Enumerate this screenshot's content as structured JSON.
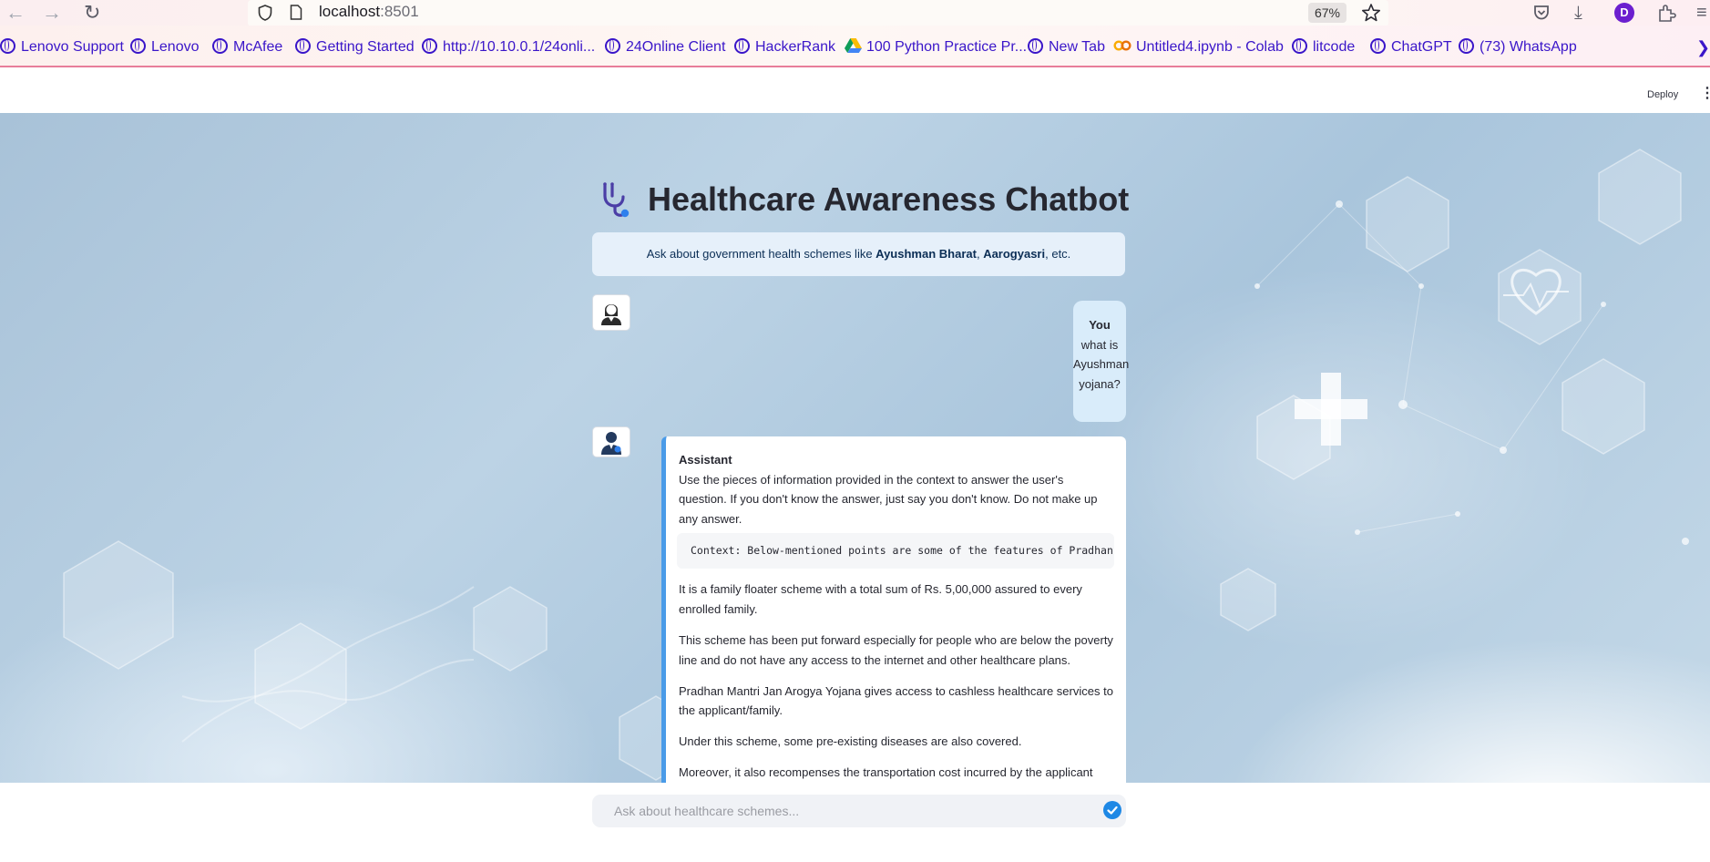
{
  "browser": {
    "url_host": "localhost",
    "url_port": ":8501",
    "zoom": "67%",
    "profile_initial": "D",
    "bookmarks": [
      {
        "label": "Lenovo Support",
        "icon": "globe-icon"
      },
      {
        "label": "Lenovo",
        "icon": "globe-icon"
      },
      {
        "label": "McAfee",
        "icon": "globe-icon"
      },
      {
        "label": "Getting Started",
        "icon": "globe-icon"
      },
      {
        "label": "http://10.10.0.1/24onli...",
        "icon": "globe-icon"
      },
      {
        "label": "24Online Client",
        "icon": "globe-icon"
      },
      {
        "label": "HackerRank",
        "icon": "globe-icon"
      },
      {
        "label": "100 Python Practice Pr...",
        "icon": "google-drive-icon"
      },
      {
        "label": "New Tab",
        "icon": "globe-icon"
      },
      {
        "label": "Untitled4.ipynb - Colab",
        "icon": "colab-icon"
      },
      {
        "label": "litcode",
        "icon": "globe-icon"
      },
      {
        "label": "ChatGPT",
        "icon": "globe-icon"
      },
      {
        "label": "(73) WhatsApp",
        "icon": "globe-icon"
      }
    ]
  },
  "app": {
    "deploy_label": "Deploy",
    "title": "Healthcare Awareness Chatbot",
    "title_icon": "stethoscope-icon",
    "info": {
      "prefix": "Ask about government health schemes like ",
      "scheme1": "Ayushman Bharat",
      "sep": ", ",
      "scheme2": "Aarogyasri",
      "suffix": ", etc."
    }
  },
  "chat": {
    "user": {
      "role_label": "You",
      "message": "what is Ayushman yojana?",
      "avatar": "user-avatar-icon"
    },
    "assistant": {
      "role_label": "Assistant",
      "avatar": "doctor-avatar-icon",
      "intro": "Use the pieces of information provided in the context to answer the user's question. If you don't know the answer, just say you don't know. Do not make up any answer.",
      "code": "Context: Below-mentioned points are some of the features of Pradhan",
      "paragraphs": [
        "It is a family floater scheme with a total sum of Rs. 5,00,000 assured to every enrolled family.",
        "This scheme has been put forward especially for people who are below the poverty line and do not have any access to the internet and other healthcare plans.",
        "Pradhan Mantri Jan Arogya Yojana gives access to cashless healthcare services to the applicant/family.",
        "Under this scheme, some pre-existing diseases are also covered.",
        "Moreover, it also recompenses the transportation cost incurred by the applicant during the treatment period."
      ]
    }
  },
  "input": {
    "placeholder": "Ask about healthcare schemes..."
  },
  "colors": {
    "accent": "#1e88e5",
    "bookmark_text": "#3a16c9",
    "user_bubble": "#d9ecfa",
    "info_box": "#e6f0fa"
  }
}
